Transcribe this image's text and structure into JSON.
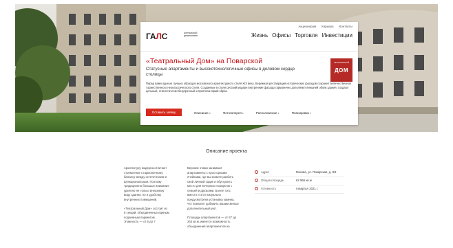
{
  "header": {
    "logo": {
      "mark_prefix": "ГА",
      "mark_accent": "Л",
      "mark_suffix": "С",
      "tagline": "Апельпьный девелопмент"
    },
    "top_links": [
      "Акционерам",
      "Карьера",
      "Контакты"
    ],
    "nav": [
      "Жизнь",
      "Офисы",
      "Торговля",
      "Инвестиции"
    ]
  },
  "project": {
    "title": "«Театральный Дом» на Поварской",
    "subtitle": "Статусные апартаменты и высокотехнологичные офисы в деловом сердце столицы",
    "badge_top": "ТЕАТРАЛЬНЫЙ",
    "badge_main": "ДОМ",
    "body": "Перед вами один из лучших образцов московского архитектурного стиля XIX века. Бережная реставрация исторических фасадов сохранит величественное торжественного неоклассического стиля. Созданные в стиле русский модерн внутренние фасады гармонично дополняют внешний облик здания, создают цельный, статистически безупречный и притягом яркий образ.",
    "cta": "Оставить заявку",
    "tabs": [
      "Описание",
      "Фотогалерея",
      "Расположение",
      "Планировки"
    ]
  },
  "description": {
    "title": "Описание проекта",
    "col1": [
      "Архитектуру модерна отличает стремление к гармоничному балансу между эстетическим и функциональным. Поэтому традиционно большое внимание уделено не только внешнему виду здания, но и удобству внутренних помещений.",
      "«Театральный Дом» состоит из 8 секций, объединенных единым подземным паркингом. Этажность — от 6 до 7"
    ],
    "col2": [
      "Верхние этажи занимают апартаменты с просторными ячейками, где вы можете разбить свой личный садик и обустроить место для вечерних посиделок с семьей и друзьями. Более того, вместо и этот визуально предусмотрена установка камина, что позволит добавить вашим жилью дополнительный уют.",
      "Площади апартаментов — от 57 до 263 кв.м, имеется возможность объединения апартаментов на"
    ],
    "info": [
      {
        "label": "Адрес",
        "value": "Москва, ул. Поварская, д. 8/1"
      },
      {
        "label": "Общая площадь",
        "value": "62 966 кв.м"
      },
      {
        "label": "Готовность",
        "value": "I квартал 2021 г."
      }
    ]
  },
  "colors": {
    "accent": "#c4161c",
    "button": "#d52b1e",
    "badge": "#b52a26"
  }
}
